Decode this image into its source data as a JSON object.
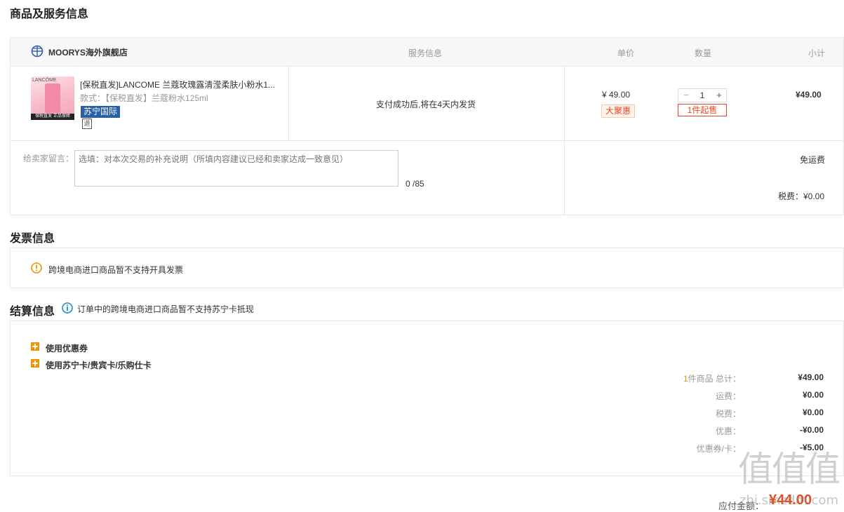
{
  "sections": {
    "goods_title": "商品及服务信息",
    "invoice_title": "发票信息",
    "settle_title": "结算信息",
    "settle_notice": "订单中的跨境电商进口商品暂不支持苏宁卡抵现"
  },
  "table_header": {
    "store_name": "MOORYS海外旗舰店",
    "service": "服务信息",
    "unit_price": "单价",
    "quantity": "数量",
    "subtotal": "小计"
  },
  "product": {
    "title": "[保税直发]LANCOME 兰蔻玫瑰露清滢柔肤小粉水1...",
    "spec_label": "款式：",
    "spec_value": "【保税直发】兰蔻粉水125ml",
    "tag": "苏宁国际",
    "return_icon_label": "退",
    "service_text": "支付成功后,将在4天内发货",
    "price": "¥ 49.00",
    "promo_badge": "大聚惠",
    "qty_minus": "−",
    "qty_value": "1",
    "qty_plus": "+",
    "min_qty": "1件起售",
    "subtotal": "¥49.00",
    "thumb_brand": "LANCÔME",
    "thumb_caption": "保税直发 正品保障"
  },
  "message": {
    "label": "给卖家留言：",
    "placeholder": "选填：对本次交易的补充说明（所填内容建议已经和卖家达成一致意见）",
    "counter": "0 /85"
  },
  "shipping": {
    "free": "免运费",
    "tax": "税费：¥0.00"
  },
  "invoice": {
    "notice": "跨境电商进口商品暂不支持开具发票"
  },
  "settlement": {
    "coupon_label": "使用优惠券",
    "card_label": "使用苏宁卡/贵宾卡/乐购仕卡",
    "item_count": "1",
    "item_total_label": "件商品 总计：",
    "item_total": "¥49.00",
    "freight_label": "运费：",
    "freight": "¥0.00",
    "tax_label": "税费：",
    "tax": "¥0.00",
    "discount_label": "优惠：",
    "discount": "-¥0.00",
    "coupon_card_label": "优惠券/卡：",
    "coupon_card": "-¥5.00",
    "payable_label": "应付金额：",
    "payable": "¥44.00"
  },
  "watermark": {
    "glyphs": "值值值",
    "site": "zhi.smzdm.com"
  },
  "colors": {
    "accent_orange": "#f29101",
    "price_red": "#e5481f",
    "tag_blue": "#2b5ea8",
    "info_blue": "#1a8cd8",
    "border": "#e8e8e8"
  }
}
